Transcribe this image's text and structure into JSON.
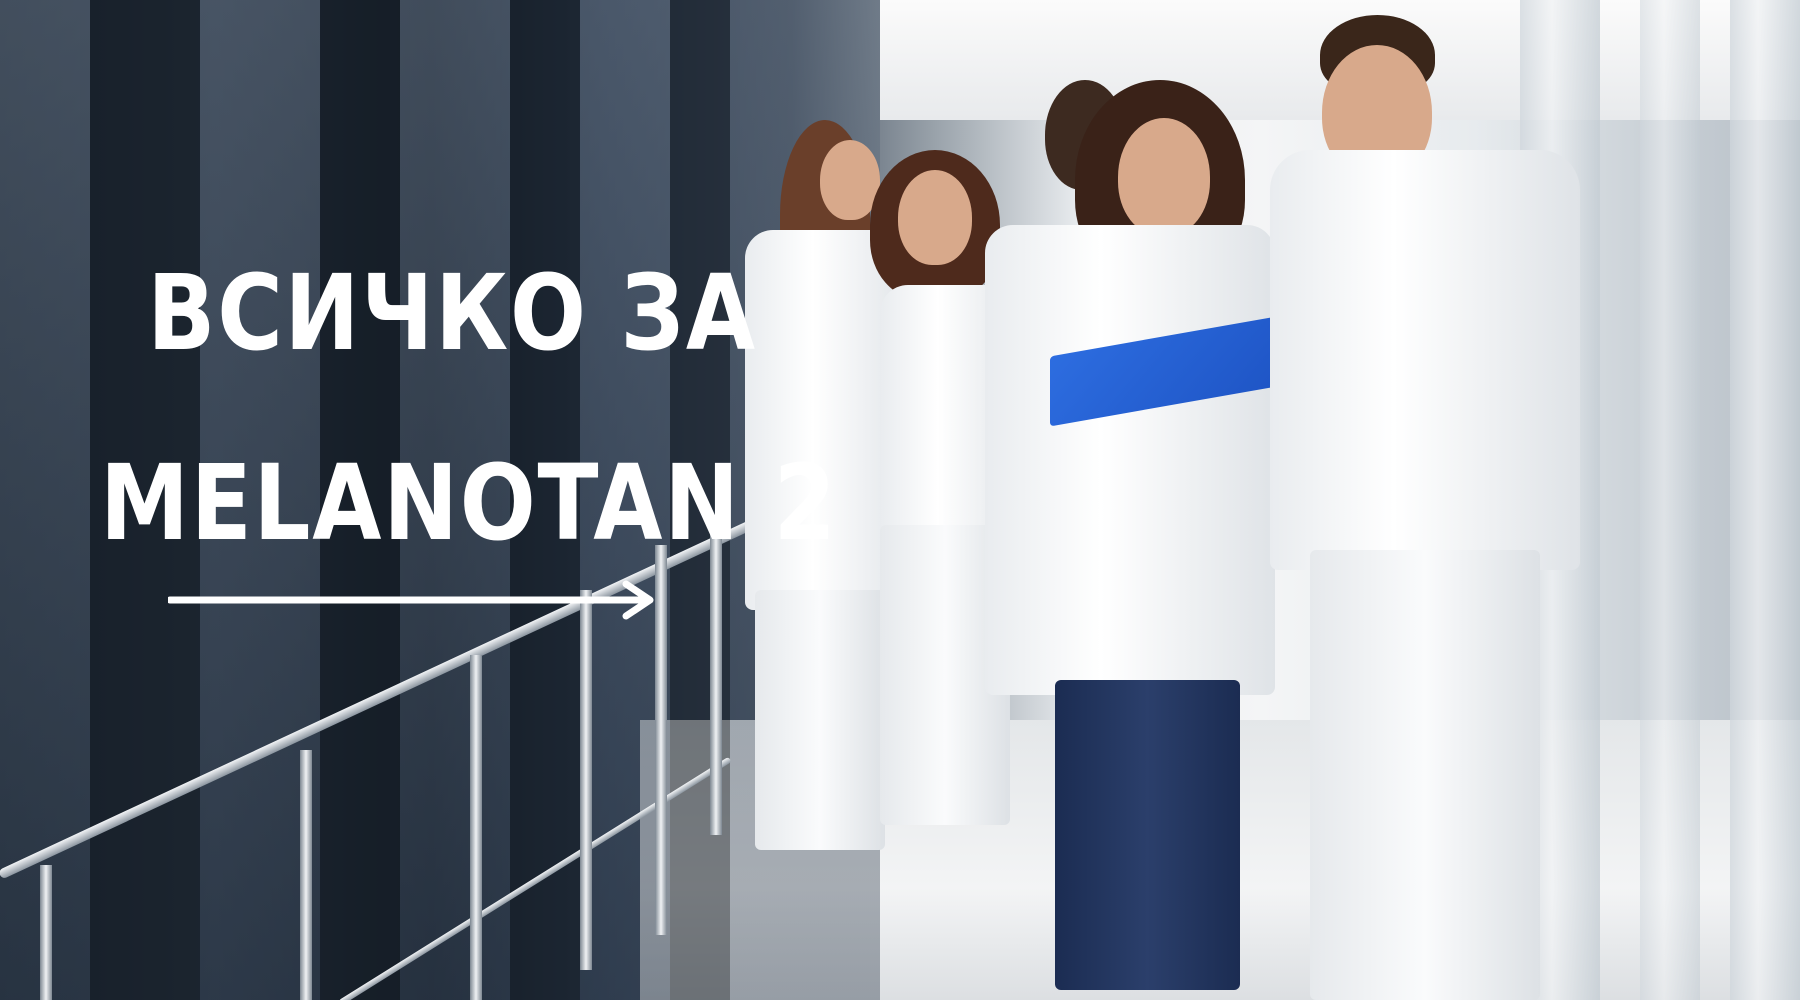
{
  "banner": {
    "title_line1": "ВСИЧКО ЗА",
    "title_line2": "MELANOTAN 2",
    "text_color": "#ffffff",
    "arrow_icon": "right-arrow-icon"
  },
  "photo": {
    "subject": "medical staff walking in a hospital corridor"
  }
}
